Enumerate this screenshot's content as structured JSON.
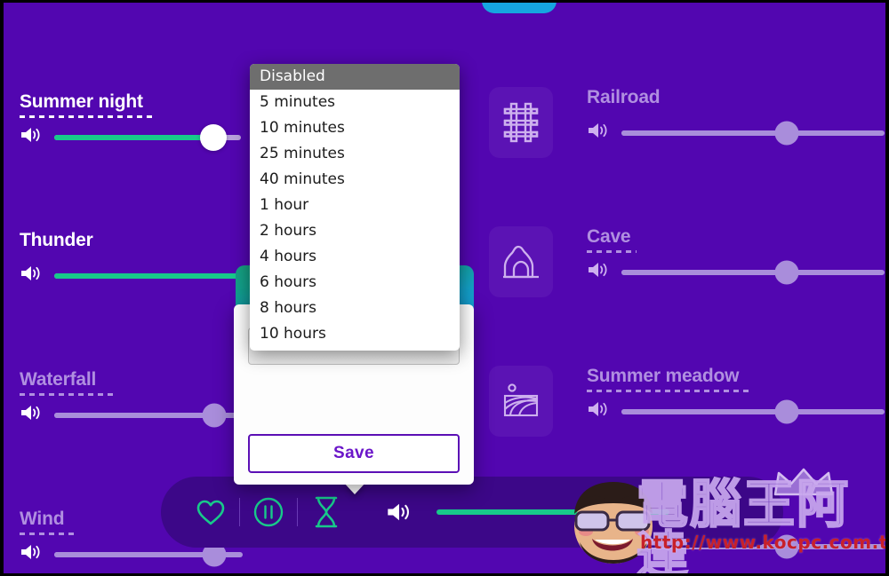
{
  "app": {
    "background_color": "#5206b0",
    "accent_green": "#18c98a",
    "accent_purple": "#6b16c9",
    "inactive_label_color": "#b08fe0"
  },
  "sounds": [
    {
      "name": "Summer night",
      "active": true,
      "volume": 85,
      "underline": true,
      "icon": null
    },
    {
      "name": "Railroad",
      "active": false,
      "volume": 63,
      "underline": false,
      "icon": "railroad-icon"
    },
    {
      "name": "Thunder",
      "active": true,
      "volume": 100,
      "underline": false,
      "icon": null
    },
    {
      "name": "Cave",
      "active": false,
      "volume": 63,
      "underline": true,
      "icon": "cave-icon"
    },
    {
      "name": "Waterfall",
      "active": false,
      "volume": 85,
      "underline": true,
      "icon": null
    },
    {
      "name": "Summer meadow",
      "active": false,
      "volume": 63,
      "underline": true,
      "icon": "meadow-icon"
    },
    {
      "name": "Wind",
      "active": false,
      "volume": 85,
      "underline": true,
      "icon": null
    },
    {
      "name": "",
      "active": false,
      "volume": 63,
      "underline": false,
      "icon": null
    }
  ],
  "timer_popup": {
    "select_value": "Disabled",
    "save_label": "Save",
    "options": [
      "Disabled",
      "5 minutes",
      "10 minutes",
      "25 minutes",
      "40 minutes",
      "1 hour",
      "2 hours",
      "4 hours",
      "6 hours",
      "8 hours",
      "10 hours"
    ],
    "selected_option": "Disabled"
  },
  "control_bar": {
    "favorite_icon": "heart-icon",
    "playpause_icon": "pause-circle-icon",
    "timer_icon": "hourglass-icon",
    "volume_icon": "speaker-icon",
    "master_volume": 100
  },
  "watermark": {
    "text": "電腦王阿達",
    "url": "http://www.kocpc.com.tw"
  }
}
